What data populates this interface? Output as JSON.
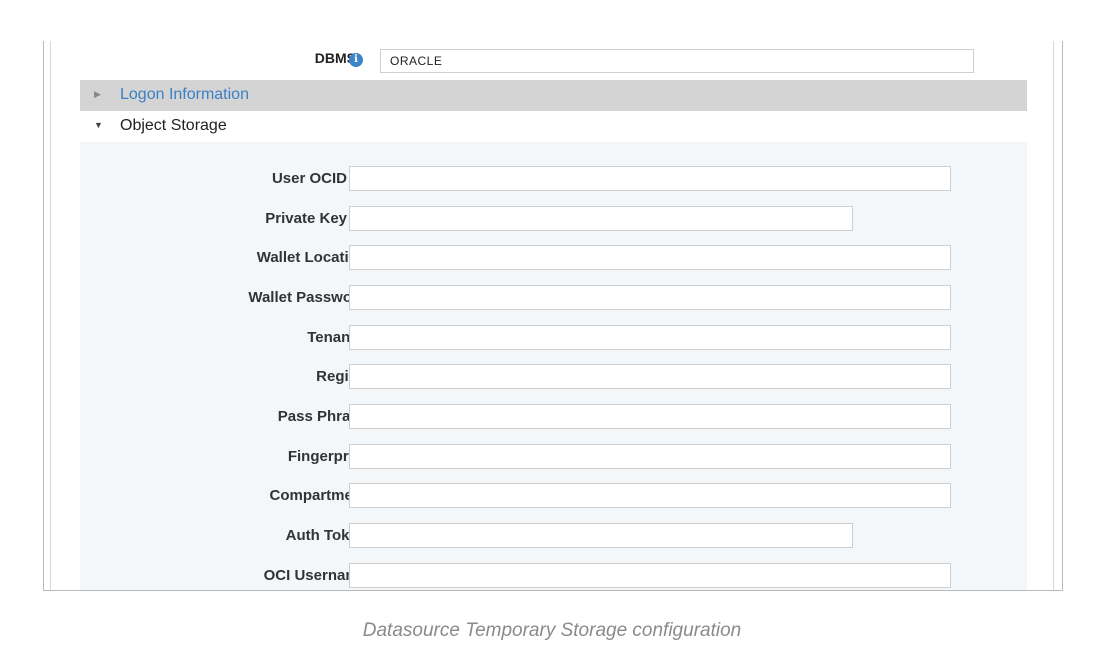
{
  "dbms": {
    "label": "DBMS",
    "value": "ORACLE"
  },
  "sections": {
    "logon": {
      "title": "Logon Information",
      "expanded": false
    },
    "object_storage": {
      "title": "Object Storage",
      "expanded": true
    }
  },
  "fields": [
    {
      "label": "User OCID",
      "value": ""
    },
    {
      "label": "Private Key",
      "value": ""
    },
    {
      "label": "Wallet Location",
      "value": ""
    },
    {
      "label": "Wallet Password",
      "value": ""
    },
    {
      "label": "Tenancy",
      "value": ""
    },
    {
      "label": "Region",
      "value": ""
    },
    {
      "label": "Pass Phrase",
      "value": ""
    },
    {
      "label": "Fingerprint",
      "value": ""
    },
    {
      "label": "Compartment",
      "value": ""
    },
    {
      "label": "Auth Token",
      "value": ""
    },
    {
      "label": "OCI Username",
      "value": ""
    }
  ],
  "colors": {
    "link": "#3b7fc4",
    "info_icon": "#3d86c8",
    "panel_bg": "#f4f7fa",
    "collapsed_header_bg": "#d4d4d4"
  },
  "icons": {
    "info": "info-icon",
    "collapsed": "caret-right-icon",
    "expanded": "caret-down-icon"
  },
  "caption": "Datasource Temporary Storage configuration"
}
